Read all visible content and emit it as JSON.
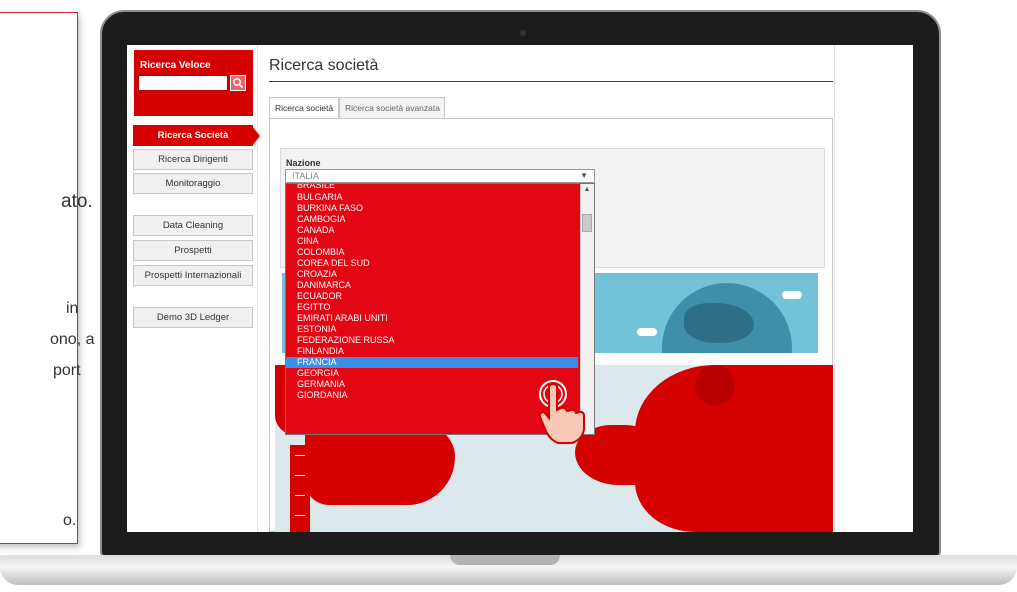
{
  "note_fragments": [
    "ato.",
    "in",
    "ono, a",
    "port",
    "o."
  ],
  "sidebar": {
    "search_title": "Ricerca Veloce",
    "search_value": "",
    "items": [
      {
        "label": "Ricerca Società",
        "active": true
      },
      {
        "label": "Ricerca Dirigenti",
        "active": false
      },
      {
        "label": "Monitoraggio",
        "active": false
      },
      {
        "label": "Data Cleaning",
        "active": false
      },
      {
        "label": "Prospetti",
        "active": false
      },
      {
        "label": "Prospetti Internazionali",
        "active": false
      },
      {
        "label": "Demo 3D Ledger",
        "active": false
      }
    ]
  },
  "main": {
    "title": "Ricerca società",
    "tabs": [
      {
        "label": "Ricerca società",
        "active": true
      },
      {
        "label": "Ricerca società avanzata",
        "active": false
      }
    ],
    "nazione_label": "Nazione",
    "selected_country": "ITALIA"
  },
  "dropdown": {
    "options": [
      "BRASILE",
      "BULGARIA",
      "BURKINA FASO",
      "CAMBOGIA",
      "CANADA",
      "CINA",
      "COLOMBIA",
      "COREA DEL SUD",
      "CROAZIA",
      "DANIMARCA",
      "ECUADOR",
      "EGITTO",
      "EMIRATI ARABI UNITI",
      "ESTONIA",
      "FEDERAZIONE RUSSA",
      "FINLANDIA",
      "FRANCIA",
      "GEORGIA",
      "GERMANIA",
      "GIORDANIA"
    ],
    "highlighted": "FRANCIA"
  },
  "colors": {
    "brand_red": "#d50000",
    "dropdown_red": "#e30613",
    "highlight_blue": "#3d8ee8",
    "banner_blue": "#72c2d8"
  },
  "icons": {
    "search_button": "search-icon",
    "hand_cursor": "hand-pointer-icon",
    "select_arrow": "chevron-down-icon"
  }
}
